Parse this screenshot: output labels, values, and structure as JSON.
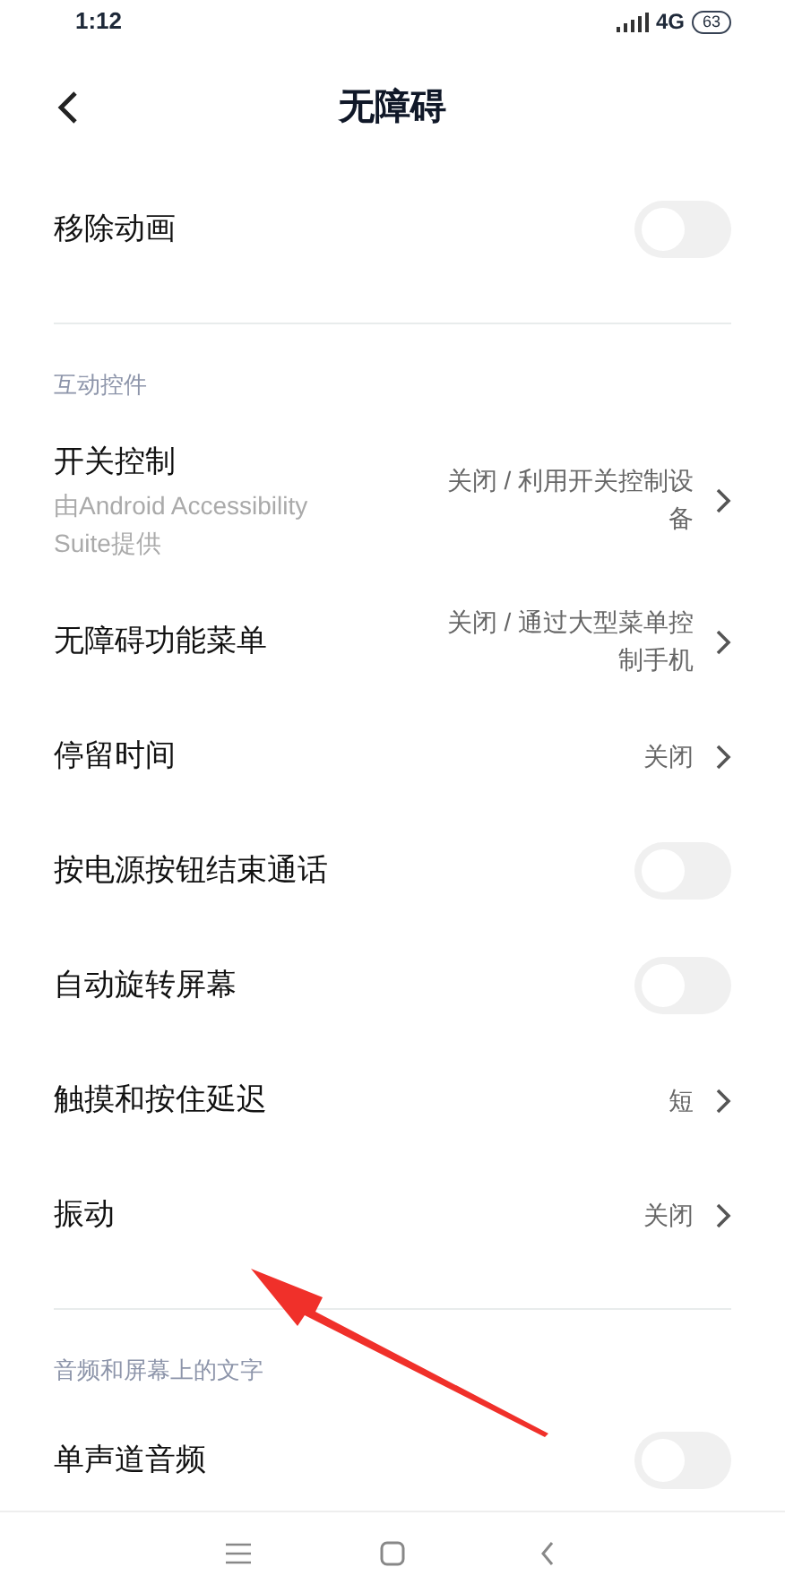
{
  "status_bar": {
    "time": "1:12",
    "network": "4G",
    "battery": "63"
  },
  "header": {
    "title": "无障碍"
  },
  "groups": [
    {
      "items": [
        {
          "kind": "toggle",
          "label": "移除动画",
          "on": false
        }
      ]
    },
    {
      "heading": "互动控件",
      "items": [
        {
          "kind": "link",
          "label": "开关控制",
          "subtitle": "由Android Accessibility Suite提供",
          "value": "关闭 / 利用开关控制设备"
        },
        {
          "kind": "link",
          "label": "无障碍功能菜单",
          "value": "关闭 / 通过大型菜单控制手机"
        },
        {
          "kind": "link",
          "label": "停留时间",
          "value": "关闭"
        },
        {
          "kind": "toggle",
          "label": "按电源按钮结束通话",
          "on": false
        },
        {
          "kind": "toggle",
          "label": "自动旋转屏幕",
          "on": false
        },
        {
          "kind": "link",
          "label": "触摸和按住延迟",
          "value": "短"
        },
        {
          "kind": "link",
          "label": "振动",
          "value": "关闭"
        }
      ]
    },
    {
      "heading": "音频和屏幕上的文字",
      "items": [
        {
          "kind": "toggle",
          "label": "单声道音频",
          "on": false
        }
      ]
    }
  ]
}
